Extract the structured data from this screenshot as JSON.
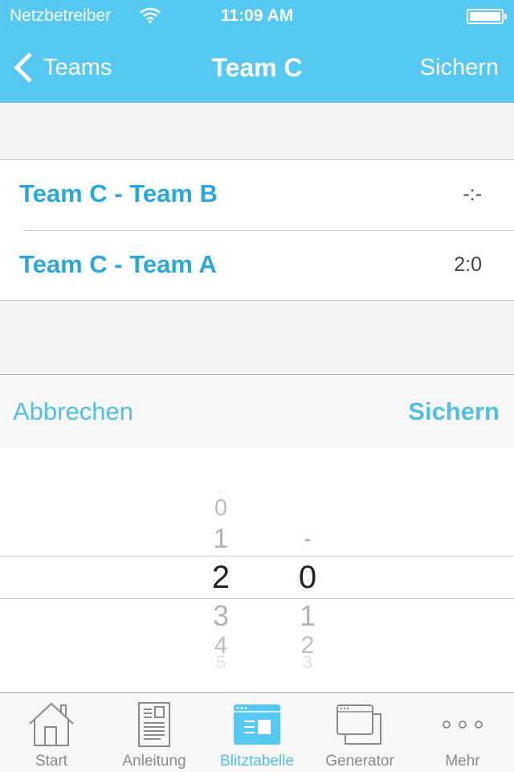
{
  "status_bar": {
    "carrier": "Netzbetreiber",
    "time": "11:09 AM",
    "wifi_icon": "wifi-icon",
    "battery_icon": "battery-full-icon"
  },
  "nav": {
    "back_label": "Teams",
    "back_icon": "chevron-left-icon",
    "title": "Team C",
    "save_label": "Sichern"
  },
  "matches": [
    {
      "title": "Team C - Team B",
      "score": "-:-"
    },
    {
      "title": "Team C - Team A",
      "score": "2:0"
    }
  ],
  "picker_toolbar": {
    "cancel_label": "Abbrechen",
    "confirm_label": "Sichern"
  },
  "score_picker": {
    "columns": [
      {
        "name": "home-goals",
        "options": [
          "-",
          "0",
          "1",
          "2",
          "3",
          "4",
          "5"
        ],
        "selected": "2"
      },
      {
        "name": "away-goals",
        "options": [
          "-",
          "0",
          "1",
          "2",
          "3"
        ],
        "selected": "0"
      }
    ]
  },
  "tabbar": {
    "tabs": [
      {
        "label": "Start",
        "icon": "house-icon",
        "active": false
      },
      {
        "label": "Anleitung",
        "icon": "document-icon",
        "active": false
      },
      {
        "label": "Blitztabelle",
        "icon": "table-window-icon",
        "active": true
      },
      {
        "label": "Generator",
        "icon": "windows-stack-icon",
        "active": false
      },
      {
        "label": "Mehr",
        "icon": "more-dots-icon",
        "active": false
      }
    ]
  },
  "colors": {
    "accent": "#55c9f2",
    "link": "#2aa7dd",
    "tab_inactive": "#8a8a8a"
  }
}
